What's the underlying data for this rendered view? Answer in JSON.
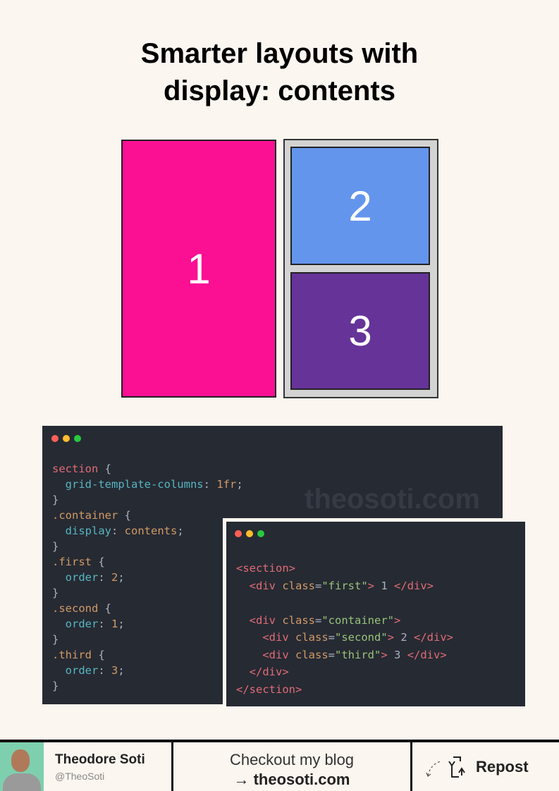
{
  "title_line1": "Smarter layouts with",
  "title_line2": "display: contents",
  "demo": {
    "box1": "1",
    "box2": "2",
    "box3": "3",
    "colors": {
      "box1": "#fb0f93",
      "box2": "#6495ed",
      "box3": "#663399",
      "container": "#d3d3d3"
    }
  },
  "watermark": "theosoti.com",
  "window_dots": [
    "#ff5f56",
    "#ffbd2e",
    "#27c93f"
  ],
  "css_code": [
    [
      [
        "section",
        "sel"
      ],
      [
        " {",
        "pun"
      ]
    ],
    [
      [
        "  grid-template-columns",
        "prop"
      ],
      [
        ": ",
        "pun"
      ],
      [
        "1fr",
        "val"
      ],
      [
        ";",
        "pun"
      ]
    ],
    [
      [
        "}",
        "pun"
      ]
    ],
    [
      [
        ".container",
        "val"
      ],
      [
        " {",
        "pun"
      ]
    ],
    [
      [
        "  display",
        "prop"
      ],
      [
        ": ",
        "pun"
      ],
      [
        "contents",
        "val"
      ],
      [
        ";",
        "pun"
      ]
    ],
    [
      [
        "}",
        "pun"
      ]
    ],
    [
      [
        ".first",
        "val"
      ],
      [
        " {",
        "pun"
      ]
    ],
    [
      [
        "  order",
        "prop"
      ],
      [
        ": ",
        "pun"
      ],
      [
        "2",
        "val"
      ],
      [
        ";",
        "pun"
      ]
    ],
    [
      [
        "}",
        "pun"
      ]
    ],
    [
      [
        ".second",
        "val"
      ],
      [
        " {",
        "pun"
      ]
    ],
    [
      [
        "  order",
        "prop"
      ],
      [
        ": ",
        "pun"
      ],
      [
        "1",
        "val"
      ],
      [
        ";",
        "pun"
      ]
    ],
    [
      [
        "}",
        "pun"
      ]
    ],
    [
      [
        ".third",
        "val"
      ],
      [
        " {",
        "pun"
      ]
    ],
    [
      [
        "  order",
        "prop"
      ],
      [
        ": ",
        "pun"
      ],
      [
        "3",
        "val"
      ],
      [
        ";",
        "pun"
      ]
    ],
    [
      [
        "}",
        "pun"
      ]
    ]
  ],
  "html_code": [
    [
      [
        "<section>",
        "tag"
      ]
    ],
    [
      [
        "  <div ",
        "tag"
      ],
      [
        "class",
        "attr"
      ],
      [
        "=",
        "pun"
      ],
      [
        "\"first\"",
        "str"
      ],
      [
        "> ",
        "tag"
      ],
      [
        "1 ",
        "pun"
      ],
      [
        "</div>",
        "tag"
      ]
    ],
    [
      [
        "",
        "pun"
      ]
    ],
    [
      [
        "  <div ",
        "tag"
      ],
      [
        "class",
        "attr"
      ],
      [
        "=",
        "pun"
      ],
      [
        "\"container\"",
        "str"
      ],
      [
        ">",
        "tag"
      ]
    ],
    [
      [
        "    <div ",
        "tag"
      ],
      [
        "class",
        "attr"
      ],
      [
        "=",
        "pun"
      ],
      [
        "\"second\"",
        "str"
      ],
      [
        "> ",
        "tag"
      ],
      [
        "2 ",
        "pun"
      ],
      [
        "</div>",
        "tag"
      ]
    ],
    [
      [
        "    <div ",
        "tag"
      ],
      [
        "class",
        "attr"
      ],
      [
        "=",
        "pun"
      ],
      [
        "\"third\"",
        "str"
      ],
      [
        "> ",
        "tag"
      ],
      [
        "3 ",
        "pun"
      ],
      [
        "</div>",
        "tag"
      ]
    ],
    [
      [
        "  </div>",
        "tag"
      ]
    ],
    [
      [
        "</section>",
        "tag"
      ]
    ]
  ],
  "footer": {
    "name": "Theodore Soti",
    "handle": "@TheoSoti",
    "blog_line1": "Checkout my blog",
    "blog_line2": "→ theosoti.com",
    "repost": "Repost"
  }
}
